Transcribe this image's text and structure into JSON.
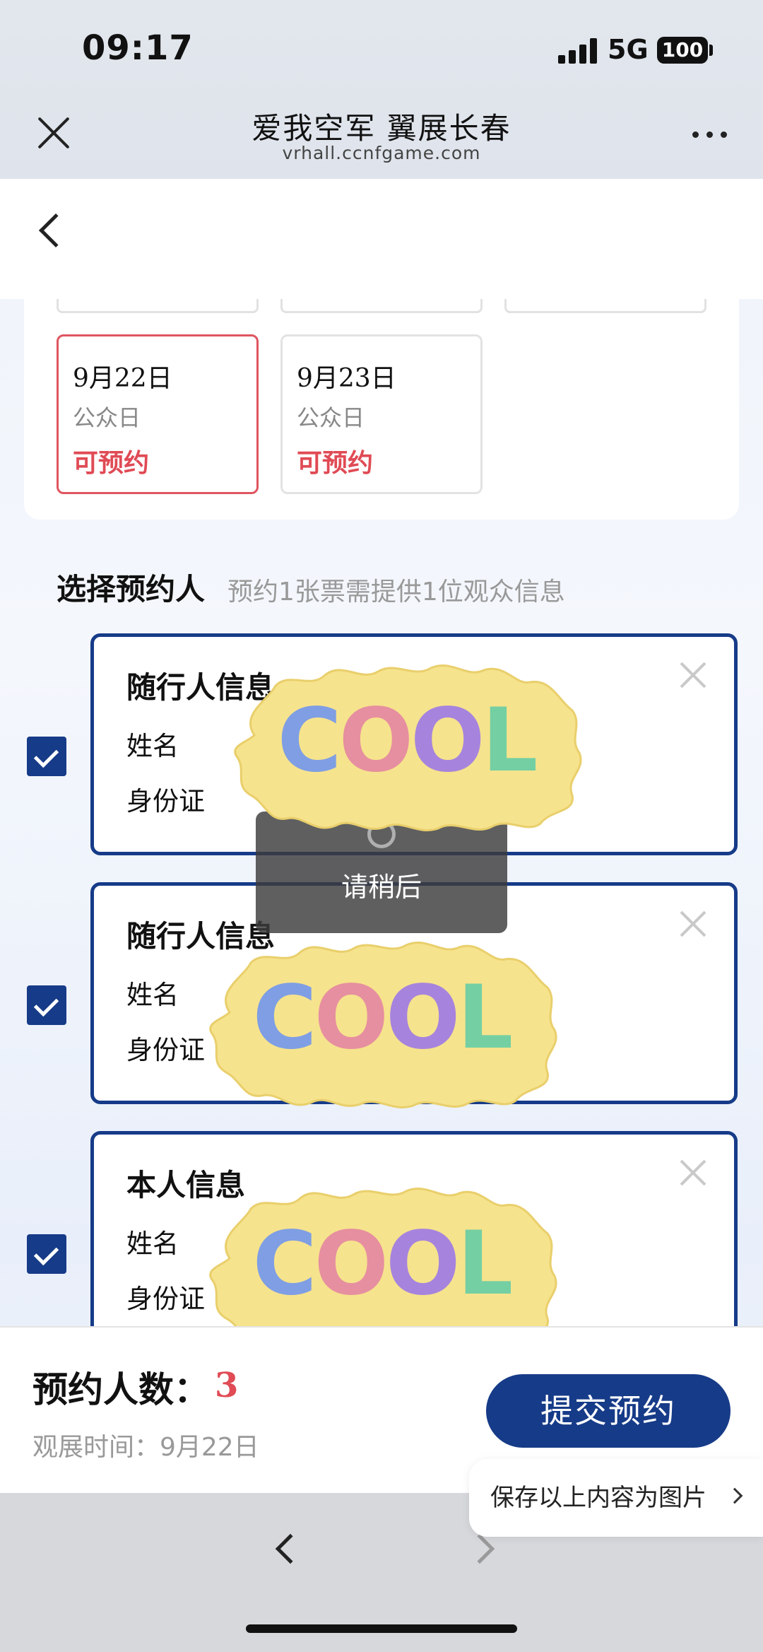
{
  "status_bar": {
    "time": "09:17",
    "network": "5G",
    "battery": "100"
  },
  "browser": {
    "title": "爱我空军 翼展长春",
    "url": "vrhall.ccnfgame.com",
    "close_icon": "close-icon",
    "more_icon": "more-icon"
  },
  "dates": [
    {
      "date": "9月22日",
      "type": "公众日",
      "status": "可预约",
      "selected": true
    },
    {
      "date": "9月23日",
      "type": "公众日",
      "status": "可预约",
      "selected": false
    }
  ],
  "section": {
    "title": "选择预约人",
    "hint": "预约1张票需提供1位观众信息"
  },
  "people": [
    {
      "title": "随行人信息",
      "name_label": "姓名",
      "id_label": "身份证",
      "checked": true
    },
    {
      "title": "随行人信息",
      "name_label": "姓名",
      "id_label": "身份证",
      "checked": true
    },
    {
      "title": "本人信息",
      "name_label": "姓名",
      "id_label": "身份证",
      "checked": true
    }
  ],
  "toast": {
    "message": "请稍后"
  },
  "sticker_text": "COOL",
  "footer": {
    "count_label": "预约人数：",
    "count_value": "3",
    "visit_time": "观展时间：9月22日",
    "submit_label": "提交预约",
    "save_label": "保存以上内容为图片"
  },
  "colors": {
    "primary": "#163b88",
    "accent_red": "#e04b55"
  }
}
